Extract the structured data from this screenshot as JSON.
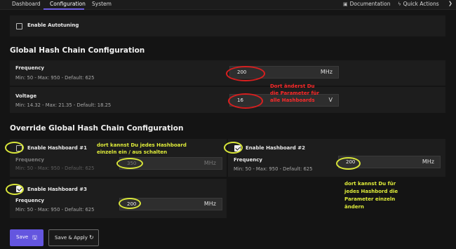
{
  "nav": {
    "tabs": [
      {
        "label": "Dashboard"
      },
      {
        "label": "Configuration"
      },
      {
        "label": "System"
      }
    ],
    "documentation": "Documentation",
    "quick_actions": "Quick Actions"
  },
  "autotuning": {
    "label": "Enable Autotuning",
    "checked": false
  },
  "global": {
    "title": "Global Hash Chain Configuration",
    "frequency": {
      "label": "Frequency",
      "meta": "Min: 50  -  Max: 950  -  Default: 625",
      "value": "200",
      "unit": "MHz"
    },
    "voltage": {
      "label": "Voltage",
      "meta": "Min: 14.32  -  Max: 21.35  -  Default: 18.25",
      "value": "16",
      "unit": "V"
    }
  },
  "override": {
    "title": "Override Global Hash Chain Configuration",
    "hashboards": [
      {
        "label": "Enable Hashboard #1",
        "checked": false,
        "freq_label": "Frequency",
        "meta": "Min: 50  -  Max: 950  -  Default: 625",
        "value": "350",
        "unit": "MHz"
      },
      {
        "label": "Enable Hashboard #2",
        "checked": true,
        "freq_label": "Frequency",
        "meta": "Min: 50  -  Max: 950  -  Default: 625",
        "value": "200",
        "unit": "MHz"
      },
      {
        "label": "Enable Hashboard #3",
        "checked": true,
        "freq_label": "Frequency",
        "meta": "Min: 50  -  Max: 950  -  Default: 625",
        "value": "200",
        "unit": "MHz"
      }
    ]
  },
  "annotations": {
    "red_note": [
      "Dort änderst Du",
      "die Parameter für",
      "alle Hashboards"
    ],
    "yellow_note_1": [
      "dort kannst Du jedes Hashboard",
      "einzeln ein / aus schalten"
    ],
    "yellow_note_2": [
      "dort kannst Du für",
      "jedes Hashbord die",
      "Parameter einzeln",
      "ändern"
    ]
  },
  "buttons": {
    "save": "Save",
    "save_apply": "Save & Apply"
  },
  "colors": {
    "accent": "#6456df",
    "annotation_red": "#d81f1f",
    "annotation_yellow": "#d9e63a"
  },
  "icons": [
    "book-icon",
    "bolt-icon",
    "chevron-right-icon",
    "save-icon",
    "refresh-icon"
  ]
}
